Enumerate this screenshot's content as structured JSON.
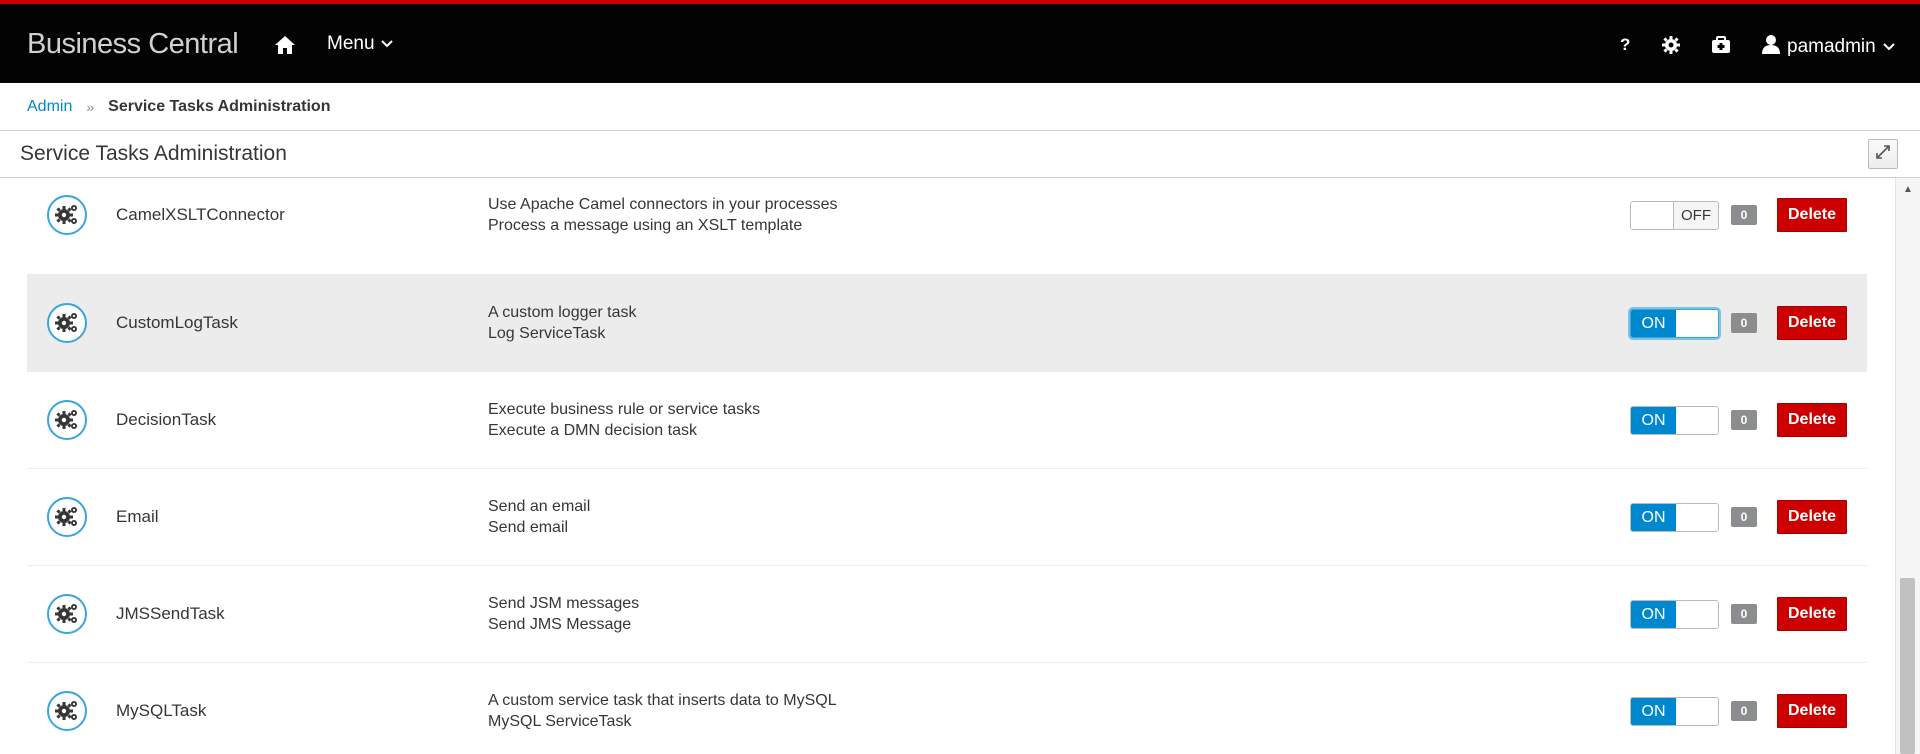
{
  "header": {
    "brand": "Business Central",
    "menu_label": "Menu",
    "help_label": "?",
    "user_name": "pamadmin"
  },
  "breadcrumb": {
    "parent": "Admin",
    "separator": "»",
    "current": "Service Tasks Administration"
  },
  "panel": {
    "title": "Service Tasks Administration"
  },
  "colors": {
    "accent_blue": "#0088ce",
    "delete_red": "#cc0000",
    "top_border": "#cc0000",
    "header_bg": "#030303"
  },
  "tasks": [
    {
      "name": "CamelXSLTConnector",
      "desc1": "Use Apache Camel connectors in your processes",
      "desc2": "Process a message using an XSLT template",
      "toggle_label": "OFF",
      "enabled": false,
      "count": "0",
      "delete_label": "Delete",
      "icon": "gears-icon"
    },
    {
      "name": "CustomLogTask",
      "desc1": "A custom logger task",
      "desc2": "Log ServiceTask",
      "toggle_label": "ON",
      "enabled": true,
      "count": "0",
      "delete_label": "Delete",
      "icon": "gears-icon"
    },
    {
      "name": "DecisionTask",
      "desc1": "Execute business rule or service tasks",
      "desc2": "Execute a DMN decision task",
      "toggle_label": "ON",
      "enabled": true,
      "count": "0",
      "delete_label": "Delete",
      "icon": "gears-icon"
    },
    {
      "name": "Email",
      "desc1": "Send an email",
      "desc2": "Send email",
      "toggle_label": "ON",
      "enabled": true,
      "count": "0",
      "delete_label": "Delete",
      "icon": "gears-icon"
    },
    {
      "name": "JMSSendTask",
      "desc1": "Send JSM messages",
      "desc2": "Send JMS Message",
      "toggle_label": "ON",
      "enabled": true,
      "count": "0",
      "delete_label": "Delete",
      "icon": "gears-icon"
    },
    {
      "name": "MySQLTask",
      "desc1": "A custom service task that inserts data to MySQL",
      "desc2": "MySQL ServiceTask",
      "toggle_label": "ON",
      "enabled": true,
      "count": "0",
      "delete_label": "Delete",
      "icon": "gears-icon"
    }
  ]
}
